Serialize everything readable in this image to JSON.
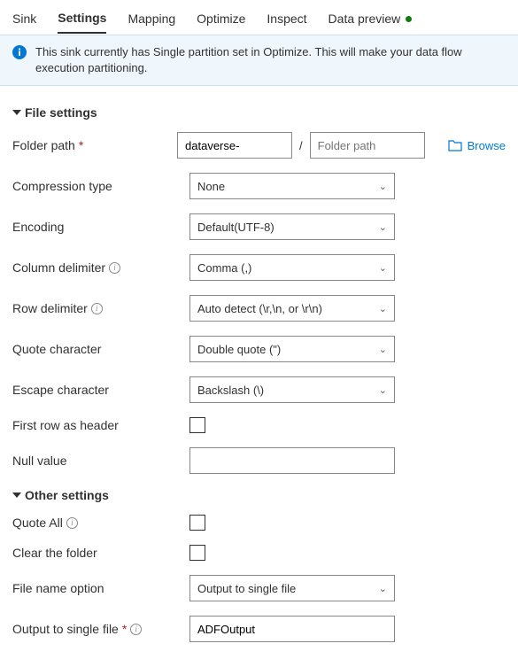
{
  "tabs": {
    "sink": "Sink",
    "settings": "Settings",
    "mapping": "Mapping",
    "optimize": "Optimize",
    "inspect": "Inspect",
    "data_preview": "Data preview"
  },
  "info_bar": "This sink currently has Single partition set in Optimize. This will make your data flow execution partitioning.",
  "sections": {
    "file_settings": "File settings",
    "other_settings": "Other settings"
  },
  "labels": {
    "folder_path": "Folder path",
    "compression_type": "Compression type",
    "encoding": "Encoding",
    "column_delimiter": "Column delimiter",
    "row_delimiter": "Row delimiter",
    "quote_character": "Quote character",
    "escape_character": "Escape character",
    "first_row_header": "First row as header",
    "null_value": "Null value",
    "quote_all": "Quote All",
    "clear_folder": "Clear the folder",
    "file_name_option": "File name option",
    "output_single_file": "Output to single file"
  },
  "values": {
    "folder_path_1": "dataverse-",
    "folder_path_2_placeholder": "Folder path",
    "compression_type": "None",
    "encoding": "Default(UTF-8)",
    "column_delimiter": "Comma (,)",
    "row_delimiter": "Auto detect (\\r,\\n, or \\r\\n)",
    "quote_character": "Double quote (\")",
    "escape_character": "Backslash (\\)",
    "null_value": "",
    "file_name_option": "Output to single file",
    "output_single_file": "ADFOutput"
  },
  "browse": "Browse",
  "required_marker": "*"
}
